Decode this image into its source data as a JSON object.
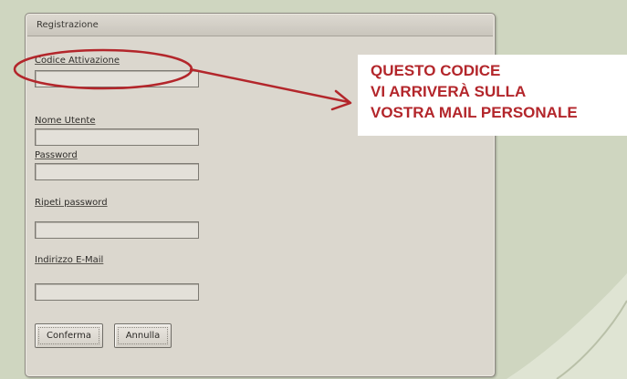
{
  "form": {
    "title": "Registrazione",
    "fields": [
      {
        "label": "Codice Attivazione",
        "value": ""
      },
      {
        "label": "Nome Utente",
        "value": ""
      },
      {
        "label": "Password",
        "value": ""
      },
      {
        "label": "Ripeti password",
        "value": ""
      },
      {
        "label": "Indirizzo E-Mail",
        "value": ""
      }
    ],
    "buttons": {
      "confirm": "Conferma",
      "cancel": "Annulla"
    }
  },
  "callout": {
    "lines": [
      "QUESTO CODICE",
      "VI ARRIVERÀ SULLA",
      "VOSTRA MAIL PERSONALE"
    ],
    "color": "#b3262b"
  }
}
